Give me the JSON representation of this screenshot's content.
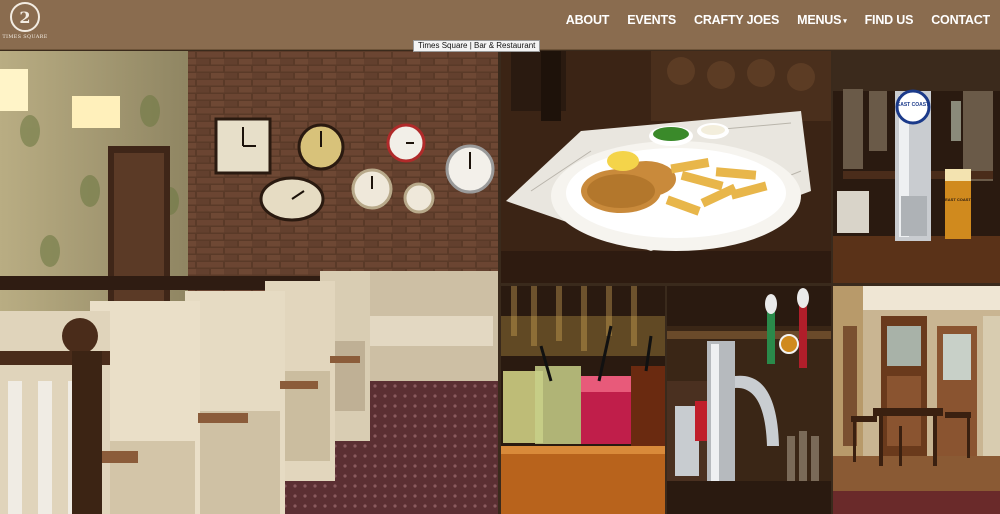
{
  "site": {
    "logo_mark": "2",
    "logo_text": "TIMES SQUARE"
  },
  "nav": {
    "items": [
      {
        "label": "ABOUT",
        "has_dropdown": false
      },
      {
        "label": "EVENTS",
        "has_dropdown": false
      },
      {
        "label": "CRAFTY JOES",
        "has_dropdown": false
      },
      {
        "label": "MENUS",
        "has_dropdown": true
      },
      {
        "label": "FIND US",
        "has_dropdown": false
      },
      {
        "label": "CONTACT",
        "has_dropdown": false
      }
    ],
    "dropdown_caret": "▾"
  },
  "tooltip": "Times Square | Bar & Restaurant",
  "gallery": {
    "photos": [
      {
        "subject": "booth-seating-with-wall-clocks"
      },
      {
        "subject": "fish-and-chips-plate"
      },
      {
        "subject": "beer-tap-at-bar"
      },
      {
        "subject": "cocktail-glasses-on-bar"
      },
      {
        "subject": "chrome-beer-taps"
      },
      {
        "subject": "dining-area-with-tables"
      }
    ],
    "pump_badge": "EAST COAST",
    "glass_label": "EAST COAST"
  },
  "colors": {
    "header_bg": "#8a6c4f",
    "nav_text": "#ffffff"
  }
}
